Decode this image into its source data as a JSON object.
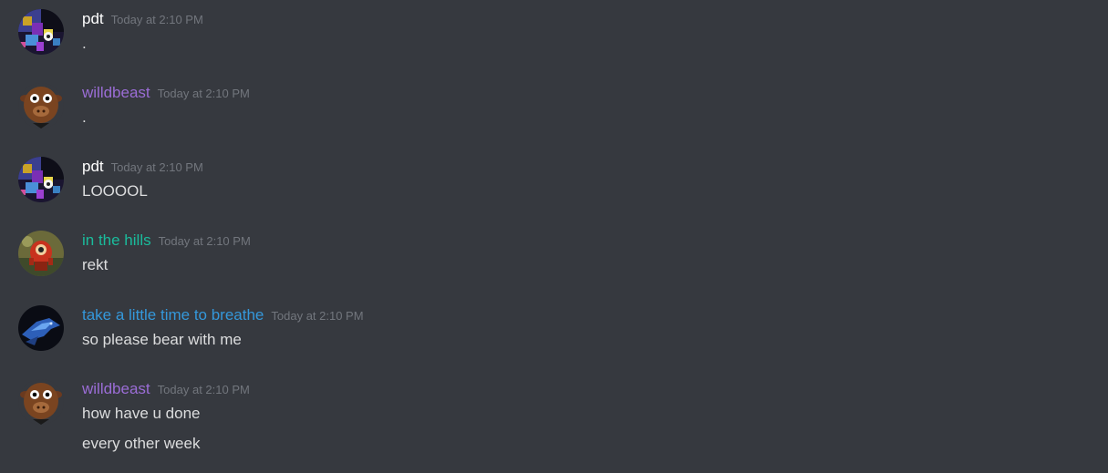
{
  "messages": [
    {
      "avatar": "pixel-art-avatar",
      "username": "pdt",
      "username_color": "#ffffff",
      "timestamp": "Today at 2:10 PM",
      "lines": [
        "."
      ]
    },
    {
      "avatar": "brown-cow-avatar",
      "username": "willdbeast",
      "username_color": "#9b6dd6",
      "timestamp": "Today at 2:10 PM",
      "lines": [
        "."
      ]
    },
    {
      "avatar": "pixel-art-avatar",
      "username": "pdt",
      "username_color": "#ffffff",
      "timestamp": "Today at 2:10 PM",
      "lines": [
        "LOOOOL"
      ]
    },
    {
      "avatar": "red-robot-avatar",
      "username": "in the hills",
      "username_color": "#1abc9c",
      "timestamp": "Today at 2:10 PM",
      "lines": [
        "rekt"
      ]
    },
    {
      "avatar": "blue-dragon-avatar",
      "username": "take a little time to breathe",
      "username_color": "#3498db",
      "timestamp": "Today at 2:10 PM",
      "lines": [
        "so please bear with me"
      ]
    },
    {
      "avatar": "brown-cow-avatar",
      "username": "willdbeast",
      "username_color": "#9b6dd6",
      "timestamp": "Today at 2:10 PM",
      "lines": [
        "how have u done",
        "every other week"
      ]
    }
  ]
}
